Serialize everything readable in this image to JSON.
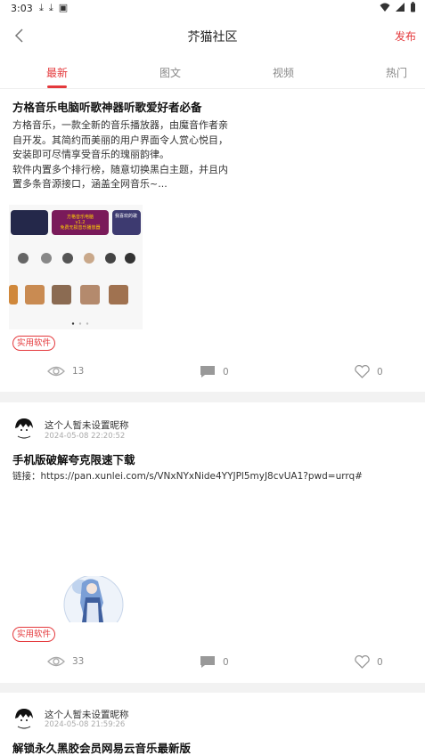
{
  "status_bar": {
    "time": "3:03",
    "left_icons": [
      "download-icon",
      "download-icon",
      "app-notification-icon"
    ],
    "right_icons": [
      "wifi-icon",
      "signal-icon",
      "battery-icon"
    ]
  },
  "app_bar": {
    "title": "芥猫社区",
    "publish_label": "发布",
    "accent_color": "#e4393c"
  },
  "tabs": [
    {
      "label": "最新",
      "active": true
    },
    {
      "label": "图文",
      "active": false
    },
    {
      "label": "视频",
      "active": false
    },
    {
      "label": "热门",
      "active": false
    }
  ],
  "posts": [
    {
      "title": "方格音乐电脑听歌神器听歌爱好者必备",
      "body_lines": [
        "方格音乐，一款全新的音乐播放器，由魔音作者亲",
        "自开发。其简约而美丽的用户界面令人赏心悦目，",
        "安装即可尽情享受音乐的瑰丽韵律。",
        "软件内置多个排行榜，随意切换黑白主题，并且内",
        "置多条音源接口，涵盖全网音乐~..."
      ],
      "image_text": {
        "banner_line1": "方格音乐电脑",
        "banner_line2": "v1.2",
        "banner_line3": "免费无损音乐播放器",
        "side_label": "我喜欢的歌"
      },
      "tag": "实用软件",
      "views": "13",
      "comments": "0",
      "likes": "0"
    },
    {
      "author": "这个人暂未设置昵称",
      "date": "2024-05-08 22:20:52",
      "title": "手机版破解夸克限速下载",
      "link": "链接：https://pan.xunlei.com/s/VNxNYxNide4YYJPl5myJ8cvUA1?pwd=urrq#",
      "tag": "实用软件",
      "views": "33",
      "comments": "0",
      "likes": "0"
    },
    {
      "author": "这个人暂未设置昵称",
      "date": "2024-05-08 21:59:26",
      "title": "解锁永久黑胶会员网易云音乐最新版"
    }
  ]
}
